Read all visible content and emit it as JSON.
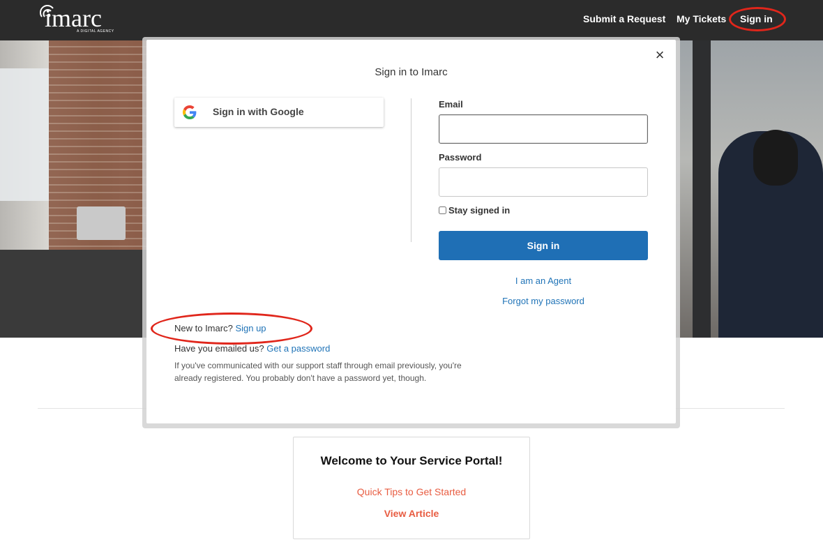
{
  "header": {
    "logo_text": "imarc",
    "logo_sub": "A DIGITAL AGENCY",
    "nav": {
      "submit": "Submit a Request",
      "tickets": "My Tickets",
      "signin": "Sign in"
    }
  },
  "modal": {
    "title": "Sign in to Imarc",
    "close": "×",
    "google_label": "Sign in with Google",
    "email_label": "Email",
    "email_value": "",
    "password_label": "Password",
    "password_value": "",
    "stay_signed_in": "Stay signed in",
    "signin_button": "Sign in",
    "agent_link": "I am an Agent",
    "forgot_link": "Forgot my password",
    "new_to_prefix": "New to Imarc?",
    "signup_link": "Sign up",
    "emailed_prefix": "Have you emailed us?",
    "get_password_link": "Get a password",
    "note": "If you've communicated with our support staff through email previously, you're already registered. You probably don't have a password yet, though."
  },
  "welcome": {
    "title": "Welcome to Your Service Portal!",
    "link": "Quick Tips to Get Started",
    "view": "View Article"
  },
  "colors": {
    "header_bg": "#2b2b2b",
    "primary_blue": "#1f6fb5",
    "link_blue": "#1f73b7",
    "accent_orange": "#e85c41",
    "annotation_red": "#e0261b"
  }
}
